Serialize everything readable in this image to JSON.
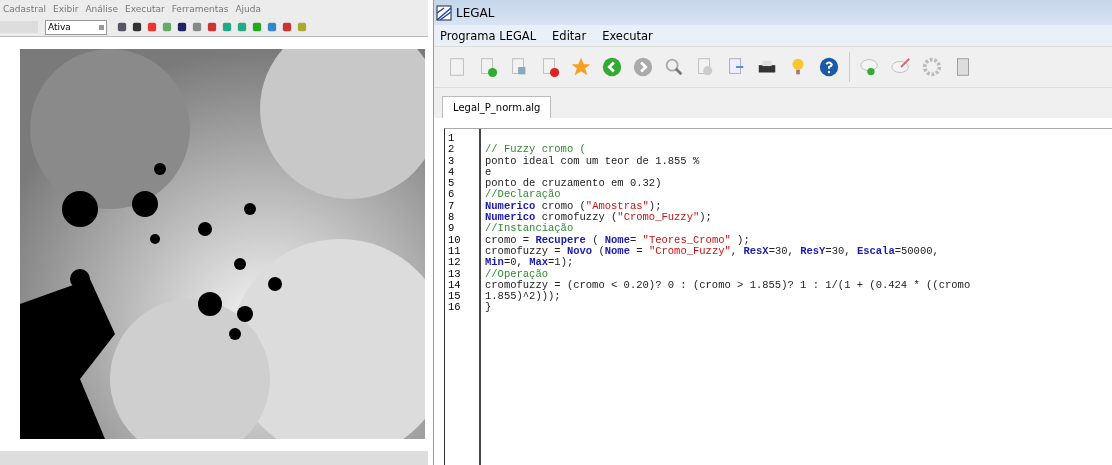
{
  "left_window": {
    "menu": [
      "Cadastral",
      "Exibir",
      "Análise",
      "Executar",
      "Ferramentas",
      "Ajuda"
    ],
    "mode_select": {
      "value": "Ativa"
    }
  },
  "right_window": {
    "title": "LEGAL",
    "menu": [
      "Programa LEGAL",
      "Editar",
      "Executar"
    ],
    "tabs": [
      {
        "label": "Legal_P_norm.alg",
        "selected": true
      }
    ],
    "editor": {
      "lines": [
        {
          "number": "1"
        },
        {
          "number": "2",
          "segments": [
            {
              "kind": "comment",
              "text": "// Fuzzy cromo ("
            }
          ]
        },
        {
          "number": "3",
          "segments": [
            {
              "kind": "plain",
              "text": "ponto ideal com um teor de 1.855 %"
            }
          ]
        },
        {
          "number": "4",
          "segments": [
            {
              "kind": "plain",
              "text": "e"
            }
          ]
        },
        {
          "number": "5",
          "segments": [
            {
              "kind": "plain",
              "text": "ponto de cruzamento em 0.32)"
            }
          ]
        },
        {
          "number": "6",
          "segments": [
            {
              "kind": "comment",
              "text": "//Declaração"
            }
          ]
        },
        {
          "number": "7",
          "segments": [
            {
              "kind": "keyword",
              "text": "Numerico"
            },
            {
              "kind": "plain",
              "text": " cromo ("
            },
            {
              "kind": "string",
              "text": "\"Amostras\""
            },
            {
              "kind": "plain",
              "text": ");"
            }
          ]
        },
        {
          "number": "8",
          "segments": [
            {
              "kind": "keyword",
              "text": "Numerico"
            },
            {
              "kind": "plain",
              "text": " cromofuzzy ("
            },
            {
              "kind": "string",
              "text": "\"Cromo_Fuzzy\""
            },
            {
              "kind": "plain",
              "text": ");"
            }
          ]
        },
        {
          "number": "9",
          "segments": [
            {
              "kind": "comment",
              "text": "//Instanciação"
            }
          ]
        },
        {
          "number": "10",
          "segments": [
            {
              "kind": "plain",
              "text": "cromo = "
            },
            {
              "kind": "keyword",
              "text": "Recupere"
            },
            {
              "kind": "plain",
              "text": " ( "
            },
            {
              "kind": "keyword",
              "text": "Nome"
            },
            {
              "kind": "plain",
              "text": "= "
            },
            {
              "kind": "string",
              "text": "\"Teores_Cromo\""
            },
            {
              "kind": "plain",
              "text": " );"
            }
          ]
        },
        {
          "number": "11",
          "segments": [
            {
              "kind": "plain",
              "text": "cromofuzzy = "
            },
            {
              "kind": "keyword",
              "text": "Novo"
            },
            {
              "kind": "plain",
              "text": " ("
            },
            {
              "kind": "keyword",
              "text": "Nome"
            },
            {
              "kind": "plain",
              "text": " = "
            },
            {
              "kind": "string",
              "text": "\"Cromo_Fuzzy\""
            },
            {
              "kind": "plain",
              "text": ", "
            },
            {
              "kind": "keyword",
              "text": "ResX"
            },
            {
              "kind": "plain",
              "text": "=30, "
            },
            {
              "kind": "keyword",
              "text": "ResY"
            },
            {
              "kind": "plain",
              "text": "=30, "
            },
            {
              "kind": "keyword",
              "text": "Escala"
            },
            {
              "kind": "plain",
              "text": "=50000,"
            }
          ]
        },
        {
          "number": "12",
          "segments": [
            {
              "kind": "keyword",
              "text": "Min"
            },
            {
              "kind": "plain",
              "text": "=0, "
            },
            {
              "kind": "keyword",
              "text": "Max"
            },
            {
              "kind": "plain",
              "text": "=1);"
            }
          ]
        },
        {
          "number": "13",
          "segments": [
            {
              "kind": "comment",
              "text": "//Operação"
            }
          ]
        },
        {
          "number": "14",
          "segments": [
            {
              "kind": "plain",
              "text": "cromofuzzy = (cromo < 0.20)? 0 : (cromo > 1.855)? 1 : 1/(1 + (0.424 * ((cromo"
            }
          ]
        },
        {
          "number": "15",
          "segments": [
            {
              "kind": "plain",
              "text": "1.855)^2)));"
            }
          ]
        },
        {
          "number": "16",
          "segments": [
            {
              "kind": "plain",
              "text": "}"
            }
          ]
        }
      ]
    }
  }
}
